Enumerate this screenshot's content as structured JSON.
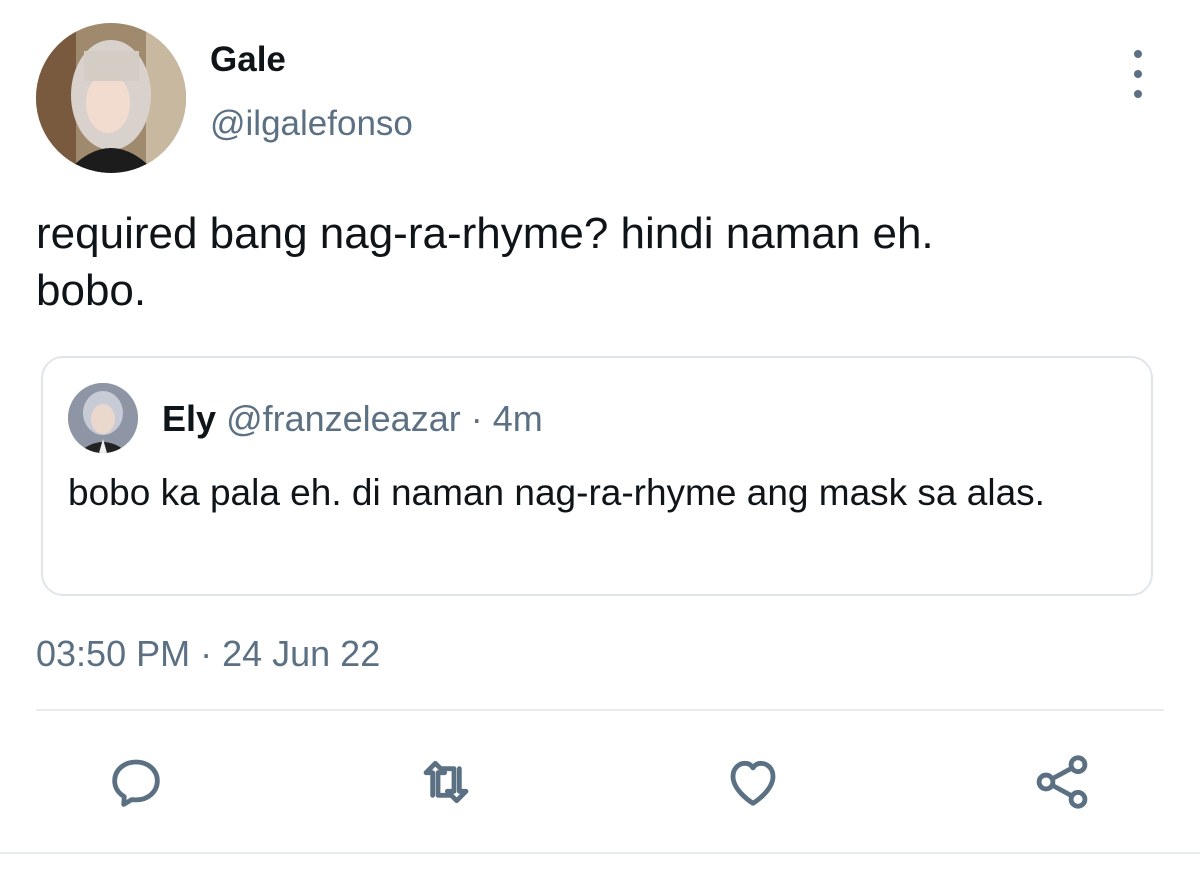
{
  "tweet": {
    "author": {
      "display_name": "Gale",
      "handle": "@ilgalefonso"
    },
    "text": "required bang nag-ra-rhyme? hindi naman eh.\nbobo.",
    "timestamp": "03:50 PM · 24 Jun 22"
  },
  "quoted_tweet": {
    "display_name": "Ely",
    "handle": "@franzeleazar",
    "separator": " · ",
    "age": "4m",
    "text": "bobo ka pala eh. di naman nag-ra-rhyme ang mask sa alas."
  },
  "icons": {
    "more": "more-vertical-icon",
    "reply": "reply-icon",
    "retweet": "retweet-icon",
    "like": "heart-icon",
    "share": "share-icon"
  },
  "colors": {
    "text_primary": "#0f1419",
    "text_secondary": "#5b7083",
    "border": "#dfe5ea"
  }
}
